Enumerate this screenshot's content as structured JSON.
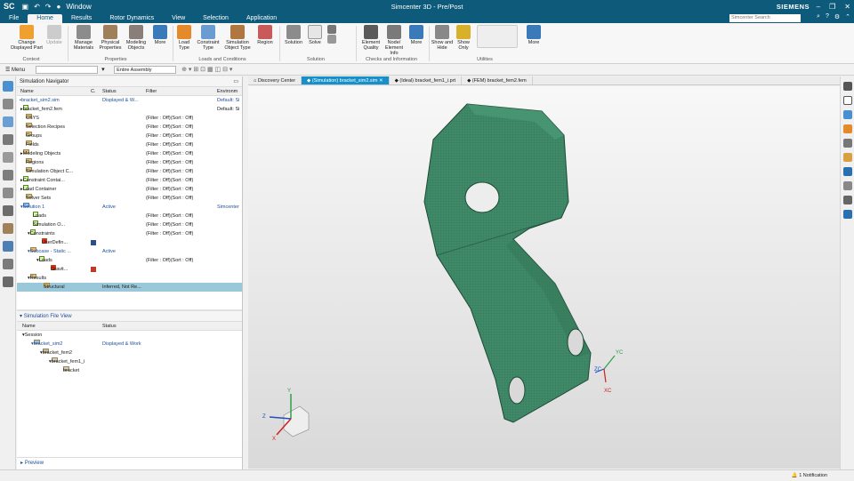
{
  "titlebar": {
    "logo": "SC",
    "window_menu": "Window",
    "app_title": "Simcenter 3D - Pre/Post",
    "brand": "SIEMENS"
  },
  "menubar": {
    "tabs": [
      "File",
      "Home",
      "Results",
      "Rotor Dynamics",
      "View",
      "Selection",
      "Application"
    ],
    "active_tab": "Home",
    "search_placeholder": "Simcenter Search"
  },
  "ribbon": {
    "buttons": {
      "change_displayed_part": "Change Displayed Part",
      "update": "Update",
      "manage_materials": "Manage Materials",
      "physical_properties": "Physical Properties",
      "modeling_objects": "Modeling Objects",
      "more1": "More",
      "load_type": "Load Type",
      "constraint_type": "Constraint Type",
      "sim_object_type": "Simulation Object Type",
      "region": "Region",
      "solution": "Solution",
      "solve": "Solve",
      "element_quality": "Element Quality",
      "node_element_info": "Node/ Element Info",
      "more2": "More",
      "show_hide": "Show and Hide",
      "show_only": "Show Only",
      "more3": "More"
    },
    "groups": {
      "context": "Context",
      "properties": "Properties",
      "loads_conditions": "Loads and Conditions",
      "solution": "Solution",
      "checks_info": "Checks and Information",
      "utilities": "Utilities"
    }
  },
  "toolbar2": {
    "menu_label": "Menu",
    "filter_value": "",
    "assembly_value": "Entire Assembly"
  },
  "navigator": {
    "title": "Simulation Navigator",
    "columns": [
      "Name",
      "C.",
      "Status",
      "Filter",
      "Environm"
    ],
    "rows": [
      {
        "name": "bracket_sim2.sim",
        "status": "Displayed & W...",
        "filter": "",
        "env": "Default: Si"
      },
      {
        "name": "bracket_fem2.fem",
        "status": "",
        "filter": "",
        "env": "Default: Si"
      },
      {
        "name": "CSYS",
        "status": "",
        "filter": "(Filter : Off)(Sort : Off)",
        "env": ""
      },
      {
        "name": "Selection Recipes",
        "status": "",
        "filter": "(Filter : Off)(Sort : Off)",
        "env": ""
      },
      {
        "name": "Groups",
        "status": "",
        "filter": "(Filter : Off)(Sort : Off)",
        "env": ""
      },
      {
        "name": "Fields",
        "status": "",
        "filter": "(Filter : Off)(Sort : Off)",
        "env": ""
      },
      {
        "name": "Modeling Objects",
        "status": "",
        "filter": "(Filter : Off)(Sort : Off)",
        "env": ""
      },
      {
        "name": "Regions",
        "status": "",
        "filter": "(Filter : Off)(Sort : Off)",
        "env": ""
      },
      {
        "name": "Simulation Object C...",
        "status": "",
        "filter": "(Filter : Off)(Sort : Off)",
        "env": ""
      },
      {
        "name": "Constraint Contai...",
        "status": "",
        "filter": "(Filter : Off)(Sort : Off)",
        "env": ""
      },
      {
        "name": "Load Container",
        "status": "",
        "filter": "(Filter : Off)(Sort : Off)",
        "env": ""
      },
      {
        "name": "Solver Sets",
        "status": "",
        "filter": "(Filter : Off)(Sort : Off)",
        "env": ""
      },
      {
        "name": "Solution 1",
        "status": "Active",
        "filter": "",
        "env": "Simcenter"
      },
      {
        "name": "Loads",
        "status": "",
        "filter": "(Filter : Off)(Sort : Off)",
        "env": ""
      },
      {
        "name": "Simulation O...",
        "status": "",
        "filter": "(Filter : Off)(Sort : Off)",
        "env": ""
      },
      {
        "name": "Constraints",
        "status": "",
        "filter": "(Filter : Off)(Sort : Off)",
        "env": ""
      },
      {
        "name": "UserDefin...",
        "status": "",
        "filter": "",
        "env": ""
      },
      {
        "name": "Subcase - Static ...",
        "status": "Active",
        "filter": "",
        "env": ""
      },
      {
        "name": "Loads",
        "status": "",
        "filter": "(Filter : Off)(Sort : Off)",
        "env": ""
      },
      {
        "name": "Gravit...",
        "status": "",
        "filter": "",
        "env": ""
      },
      {
        "name": "Results",
        "status": "",
        "filter": "",
        "env": ""
      },
      {
        "name": "Structural",
        "status": "Inferred, Not Re...",
        "filter": "",
        "env": ""
      }
    ]
  },
  "file_view": {
    "title": "Simulation File View",
    "columns": [
      "Name",
      "Status"
    ],
    "rows": [
      {
        "name": "Session",
        "status": ""
      },
      {
        "name": "bracket_sim2",
        "status": "Displayed & Work"
      },
      {
        "name": "bracket_fem2",
        "status": ""
      },
      {
        "name": "bracket_fem1_i",
        "status": ""
      },
      {
        "name": "bracket",
        "status": ""
      }
    ],
    "preview_label": "Preview"
  },
  "view_tabs": [
    {
      "label": "Discovery Center"
    },
    {
      "label": "(Simulation) bracket_sim2.sim"
    },
    {
      "label": "(Ideal) bracket_fem1_i.prt"
    },
    {
      "label": "(FEM) bracket_fem2.fem"
    }
  ],
  "viewport": {
    "wcs_labels": [
      "YC",
      "ZC",
      "XC"
    ],
    "triad_labels": [
      "Y",
      "Z",
      "X"
    ]
  },
  "status": {
    "notifications": "1 Notification"
  },
  "colors": {
    "titlebar": "#0e5a7a",
    "active_tab": "#1690c9",
    "mesh_green": "#3f8a68",
    "selection_row": "#9bc7db"
  }
}
